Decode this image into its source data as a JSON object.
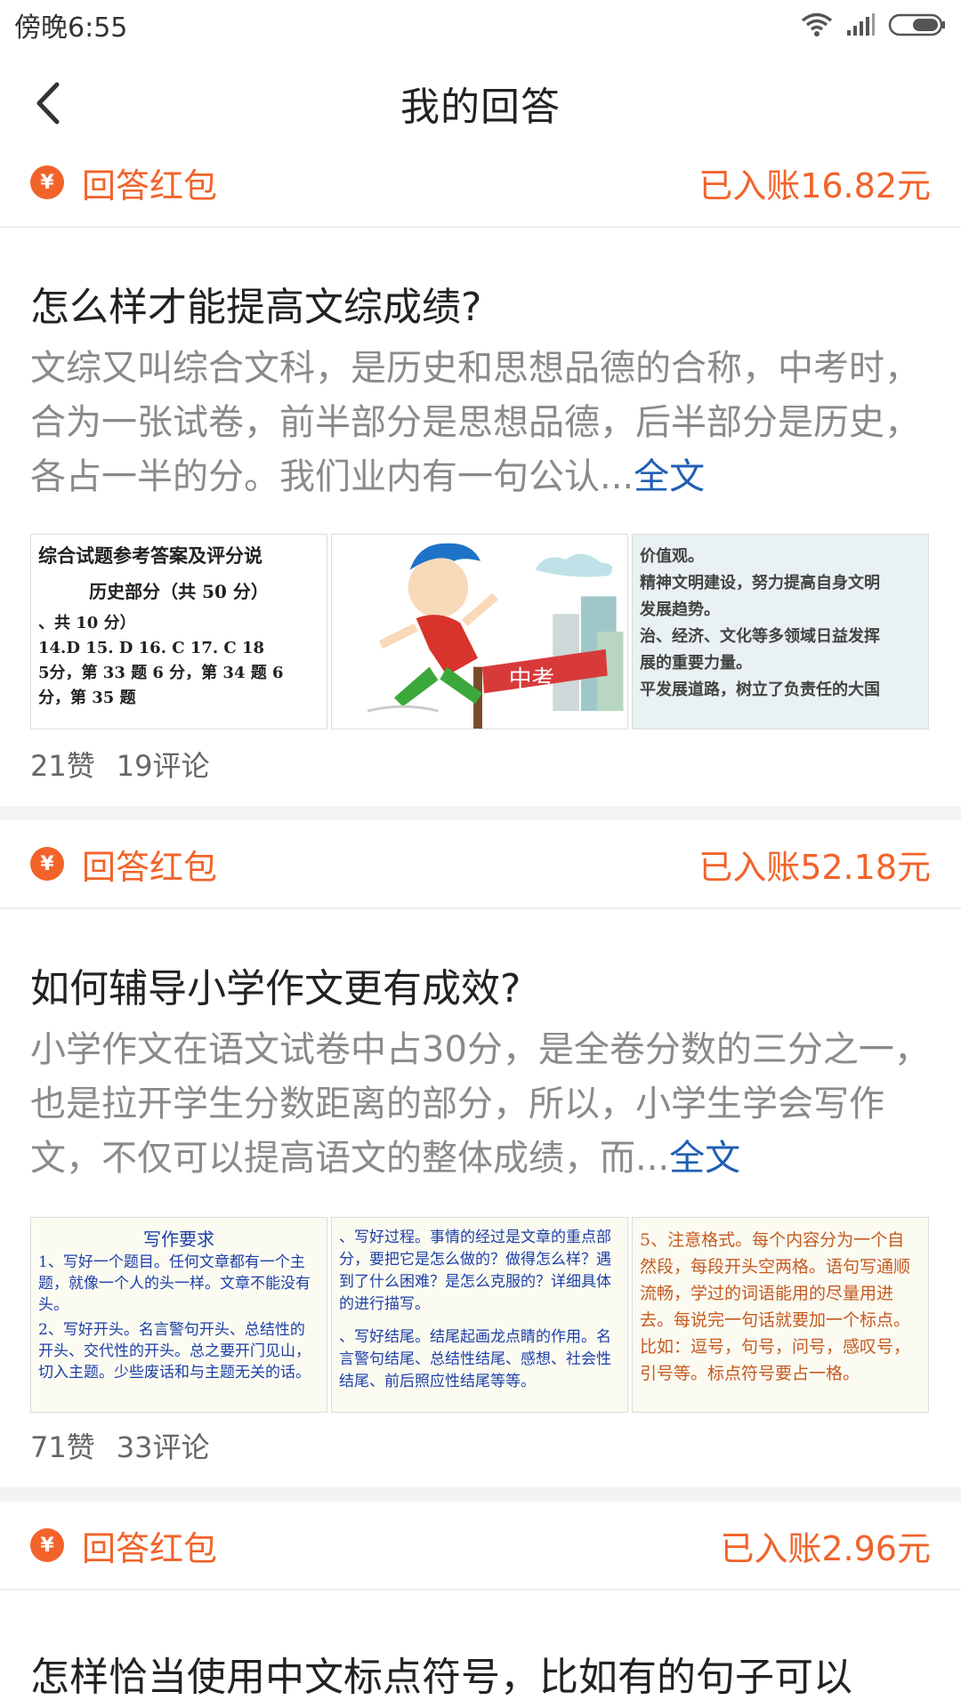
{
  "status": {
    "time": "傍晚6:55"
  },
  "header": {
    "title": "我的回答"
  },
  "cards": [
    {
      "redpacket_label": "回答红包",
      "redpacket_icon": "¥",
      "amount": "已入账16.82元",
      "title": "怎么样才能提高文综成绩?",
      "body": "文综又叫综合文科，是历史和思想品德的合称，中考时，合为一张试卷，前半部分是思想品德，后半部分是历史，各占一半的分。我们业内有一句公认...",
      "more": "全文",
      "likes": "21赞",
      "comments": "19评论",
      "thumbs": [
        {
          "lines": [
            "综合试题参考答案及评分说",
            "历史部分（共 50 分）",
            "、共 10 分）",
            "14.D  15. D  16. C  17. C  18",
            "5分，第 33 题 6 分，第 34 题 6 分，第 35 题"
          ]
        },
        {
          "caption": "中考"
        },
        {
          "lines": [
            "价值观。",
            "精神文明建设，努力提高自身文明",
            "发展趋势。",
            "治、经济、文化等多领域日益发挥",
            "展的重要力量。",
            "平发展道路，树立了负责任的大国"
          ]
        }
      ]
    },
    {
      "redpacket_label": "回答红包",
      "redpacket_icon": "¥",
      "amount": "已入账52.18元",
      "title": "如何辅导小学作文更有成效?",
      "body": "小学作文在语文试卷中占30分，是全卷分数的三分之一，也是拉开学生分数距离的部分，所以，小学生学会写作文，不仅可以提高语文的整体成绩，而...",
      "more": "全文",
      "likes": "71赞",
      "comments": "33评论",
      "thumbs": [
        {
          "lines": [
            "写作要求",
            "1、写好一个题目。任何文章都有一个主题，就像一个人的头一样。文章不能没有头。",
            "2、写好开头。名言警句开头、总结性的开头、交代性的开头。总之要开门见山，切入主题。少些废话和与主题无关的话。"
          ]
        },
        {
          "lines": [
            "、写好过程。事情的经过是文章的重点部分，要把它是怎么做的？做得怎么样？遇到了什么困难？是怎么克服的？详细具体的进行描写。",
            "、写好结尾。结尾起画龙点睛的作用。名言警句结尾、总结性结尾、感想、社会性结尾、前后照应性结尾等等。"
          ]
        },
        {
          "lines": [
            "5、注意格式。每个内容分为一个自然段，每段开头空两格。语句写通顺流畅，学过的词语能用的尽量用进去。每说完一句话就要加一个标点。比如：逗号，句号，问号，感叹号，引号等。标点符号要占一格。"
          ]
        }
      ]
    },
    {
      "redpacket_label": "回答红包",
      "redpacket_icon": "¥",
      "amount": "已入账2.96元",
      "title": "怎样恰当使用中文标点符号，比如有的句子可以"
    }
  ]
}
